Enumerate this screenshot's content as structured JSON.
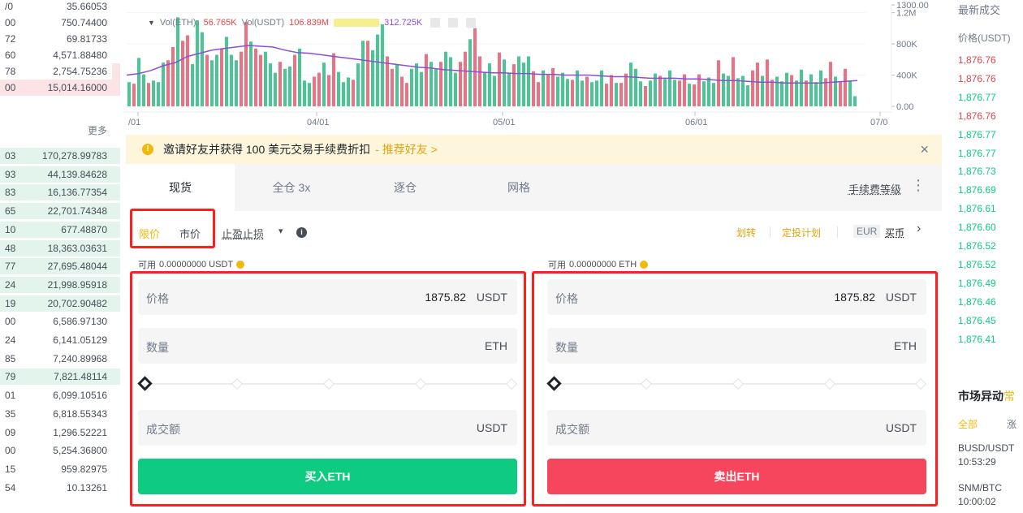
{
  "colors": {
    "ask_red": "#e0464b",
    "bid_green": "#0ecb81",
    "accent_yellow": "#f0b90b",
    "highlight_red": "#ff1f1f"
  },
  "orderbook": {
    "asks": [
      {
        "price": "/0",
        "total": "35.66053"
      },
      {
        "price": "00",
        "total": "750.74400"
      },
      {
        "price": "72",
        "total": "69.81733"
      },
      {
        "price": "60",
        "total": "4,571.88480"
      },
      {
        "price": "78",
        "total": "2,754.75236"
      },
      {
        "price": "00",
        "total": "15,014.16000"
      }
    ],
    "more_label": "更多",
    "bids": [
      {
        "price": "03",
        "total": "170,278.99783"
      },
      {
        "price": "93",
        "total": "44,139.84628"
      },
      {
        "price": "83",
        "total": "16,136.77354"
      },
      {
        "price": "65",
        "total": "22,701.74348"
      },
      {
        "price": "10",
        "total": "677.48870"
      },
      {
        "price": "48",
        "total": "18,363.03631"
      },
      {
        "price": "77",
        "total": "27,695.48044"
      },
      {
        "price": "24",
        "total": "21,998.95918"
      },
      {
        "price": "19",
        "total": "20,702.90482"
      },
      {
        "price": "00",
        "total": "6,586.97130"
      },
      {
        "price": "24",
        "total": "6,141.05129"
      },
      {
        "price": "85",
        "total": "7,240.89968"
      },
      {
        "price": "79",
        "total": "7,821.48114"
      },
      {
        "price": "01",
        "total": "6,099.10516"
      },
      {
        "price": "35",
        "total": "6,818.55343"
      },
      {
        "price": "09",
        "total": "1,296.52221"
      },
      {
        "price": "00",
        "total": "5,254.36800"
      },
      {
        "price": "15",
        "total": "959.82975"
      },
      {
        "price": "54",
        "total": "10.13261"
      }
    ]
  },
  "chart": {
    "vol_eth_label": "Vol(ETH):",
    "vol_eth_value": "56.765K",
    "vol_usdt_label": "Vol(USDT)",
    "vol_usdt_value": "106.839M",
    "ma_value": "312.725K",
    "x_ticks": [
      "/01",
      "04/01",
      "05/01",
      "06/01",
      "07/0"
    ],
    "y_ticks": [
      "1300.00",
      "1.2M",
      "800K",
      "400K",
      "0.00"
    ]
  },
  "chart_data": {
    "type": "bar",
    "xlabel": "",
    "ylabel": "",
    "x_ticks": [
      "/01",
      "04/01",
      "05/01",
      "06/01",
      "07/0"
    ],
    "ylim": [
      0,
      1300000
    ],
    "series": [
      {
        "values": [
          310000,
          290000,
          620000,
          410000,
          300000,
          330000,
          310000,
          560000,
          590000,
          760000,
          1140000,
          840000,
          910000,
          540000,
          1100000,
          950000,
          660000,
          590000,
          660000,
          740000,
          890000,
          660000,
          590000,
          700000,
          1080000,
          830000,
          740000,
          660000,
          700000,
          550000,
          430000,
          570000,
          480000,
          510000,
          660000,
          740000,
          330000,
          300000,
          380000,
          430000,
          560000,
          400000,
          680000,
          440000,
          310000,
          370000,
          340000,
          550000,
          840000,
          840000,
          720000,
          920000,
          1050000,
          640000,
          480000,
          540000,
          380000,
          300000,
          480000,
          550000,
          440000,
          670000,
          570000,
          480000,
          570000,
          700000,
          630000,
          430000,
          570000,
          700000,
          860000,
          1000000,
          640000,
          430000,
          550000,
          390000,
          690000,
          600000,
          430000,
          540000,
          640000,
          560000,
          640000,
          450000,
          310000,
          460000,
          400000,
          490000,
          380000,
          430000,
          350000,
          340000,
          460000,
          330000,
          380000,
          310000,
          330000,
          460000,
          290000,
          400000,
          300000,
          300000,
          420000,
          560000,
          480000,
          320000,
          260000,
          330000,
          420000,
          390000,
          350000,
          460000,
          340000,
          330000,
          410000,
          290000,
          280000,
          410000,
          320000,
          370000,
          300000,
          590000,
          420000,
          390000,
          630000,
          360000,
          390000,
          270000,
          460000,
          560000,
          390000,
          600000,
          340000,
          380000,
          320000,
          430000,
          400000,
          330000,
          470000,
          330000,
          410000,
          310000,
          460000,
          360000,
          570000,
          380000,
          310000,
          480000,
          330000,
          130000
        ]
      },
      {
        "values": [
          400000,
          420000,
          460000,
          520000,
          560000,
          640000,
          680000,
          720000,
          740000,
          760000,
          780000,
          770000,
          760000,
          720000,
          690000,
          680000,
          660000,
          640000,
          620000,
          600000,
          580000,
          560000,
          540000,
          520000,
          500000,
          490000,
          470000,
          460000,
          450000,
          440000,
          430000,
          430000,
          420000,
          420000,
          410000,
          410000,
          400000,
          400000,
          400000,
          390000,
          380000,
          380000,
          370000,
          360000,
          360000,
          360000,
          350000,
          350000,
          340000,
          330000,
          330000,
          320000,
          310000,
          310000,
          300000,
          300000,
          300000,
          300000,
          310000,
          320000,
          330000
        ]
      }
    ]
  },
  "banner": {
    "text": "邀请好友并获得 100 美元交易手续费折扣",
    "link": "- 推荐好友 >",
    "close": "×"
  },
  "tabs": {
    "items": [
      "现货",
      "全仓 3x",
      "逐仓",
      "网格"
    ],
    "fee_level": "手续费等级",
    "more": "⋮"
  },
  "order_types": {
    "limit": "限价",
    "market": "市价",
    "stop": "止盈止损",
    "stop_caret": "▾",
    "info": "i",
    "transfer": "划转",
    "auto_invest": "定投计划",
    "currency": "EUR",
    "buy_coin": "买币",
    "chevron": "›"
  },
  "buy_form": {
    "available_label": "可用",
    "available_value": "0.00000000 USDT",
    "price_label": "价格",
    "price_value": "1875.82",
    "price_unit": "USDT",
    "amount_label": "数量",
    "amount_unit": "ETH",
    "slider_percent": 0,
    "total_label": "成交额",
    "total_unit": "USDT",
    "submit": "买入ETH"
  },
  "sell_form": {
    "available_label": "可用",
    "available_value": "0.00000000 ETH",
    "price_label": "价格",
    "price_value": "1875.82",
    "price_unit": "USDT",
    "amount_label": "数量",
    "amount_unit": "ETH",
    "slider_percent": 0,
    "total_label": "成交额",
    "total_unit": "USDT",
    "submit": "卖出ETH"
  },
  "trades": {
    "title": "最新成交",
    "header_price": "价格(USDT)",
    "items": [
      {
        "price": "1,876.76",
        "side": "sell"
      },
      {
        "price": "1,876.76",
        "side": "sell"
      },
      {
        "price": "1,876.77",
        "side": "buy"
      },
      {
        "price": "1,876.76",
        "side": "sell"
      },
      {
        "price": "1,876.77",
        "side": "buy"
      },
      {
        "price": "1,876.77",
        "side": "buy"
      },
      {
        "price": "1,876.73",
        "side": "buy"
      },
      {
        "price": "1,876.69",
        "side": "buy"
      },
      {
        "price": "1,876.61",
        "side": "buy"
      },
      {
        "price": "1,876.60",
        "side": "buy"
      },
      {
        "price": "1,876.52",
        "side": "buy"
      },
      {
        "price": "1,876.52",
        "side": "buy"
      },
      {
        "price": "1,876.49",
        "side": "buy"
      },
      {
        "price": "1,876.46",
        "side": "buy"
      },
      {
        "price": "1,876.45",
        "side": "buy"
      },
      {
        "price": "1,876.41",
        "side": "buy"
      }
    ]
  },
  "market": {
    "title": "市场异动",
    "title_suffix": "常",
    "tab_all": "全部",
    "tab_gain": "涨",
    "pairs": [
      {
        "pair": "BUSD/USDT",
        "time": "10:53:29"
      },
      {
        "pair": "SNM/BTC",
        "time": "10:00:02"
      }
    ]
  }
}
